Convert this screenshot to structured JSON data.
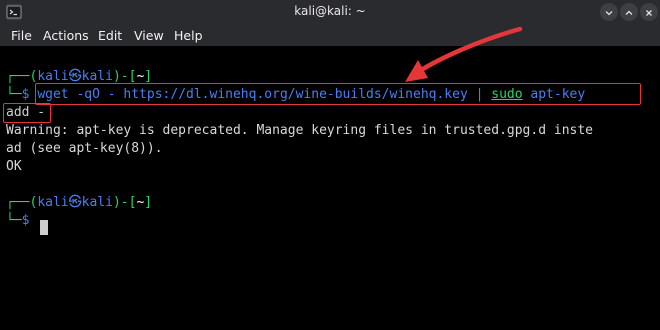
{
  "window": {
    "title": "kali@kali: ~"
  },
  "menu": {
    "items": [
      "File",
      "Actions",
      "Edit",
      "View",
      "Help"
    ]
  },
  "terminal": {
    "prompt1": {
      "open": "┌──(",
      "user": "kali",
      "at": "㉿",
      "host": "kali",
      "close": ")-[",
      "dir": "~",
      "end": "]",
      "dollar_prefix": "└─",
      "dollar": "$"
    },
    "command": {
      "part1": "wget -qO - https://dl.winehq.org/wine-builds/winehq.key | ",
      "sudo": "sudo",
      "part2": " apt-key",
      "continuation": "add -"
    },
    "output": [
      "Warning: apt-key is deprecated. Manage keyring files in trusted.gpg.d inste",
      "ad (see apt-key(8)).",
      "OK"
    ],
    "prompt2": {
      "open": "┌──(",
      "user": "kali",
      "at": "㉿",
      "host": "kali",
      "close": ")-[",
      "dir": "~",
      "end": "]",
      "dollar_prefix": "└─",
      "dollar": "$"
    }
  },
  "colors": {
    "prompt_blue": "#4a7ef0",
    "prompt_green": "#2ed36a",
    "annotation_red": "#e5363a",
    "titlebar": "#2a2b2f",
    "background": "#000000"
  },
  "icons": {
    "app": "terminal-icon",
    "minimize": "minimize-icon",
    "maximize": "maximize-icon",
    "close": "close-icon",
    "annotation": "red-arrow-icon"
  }
}
